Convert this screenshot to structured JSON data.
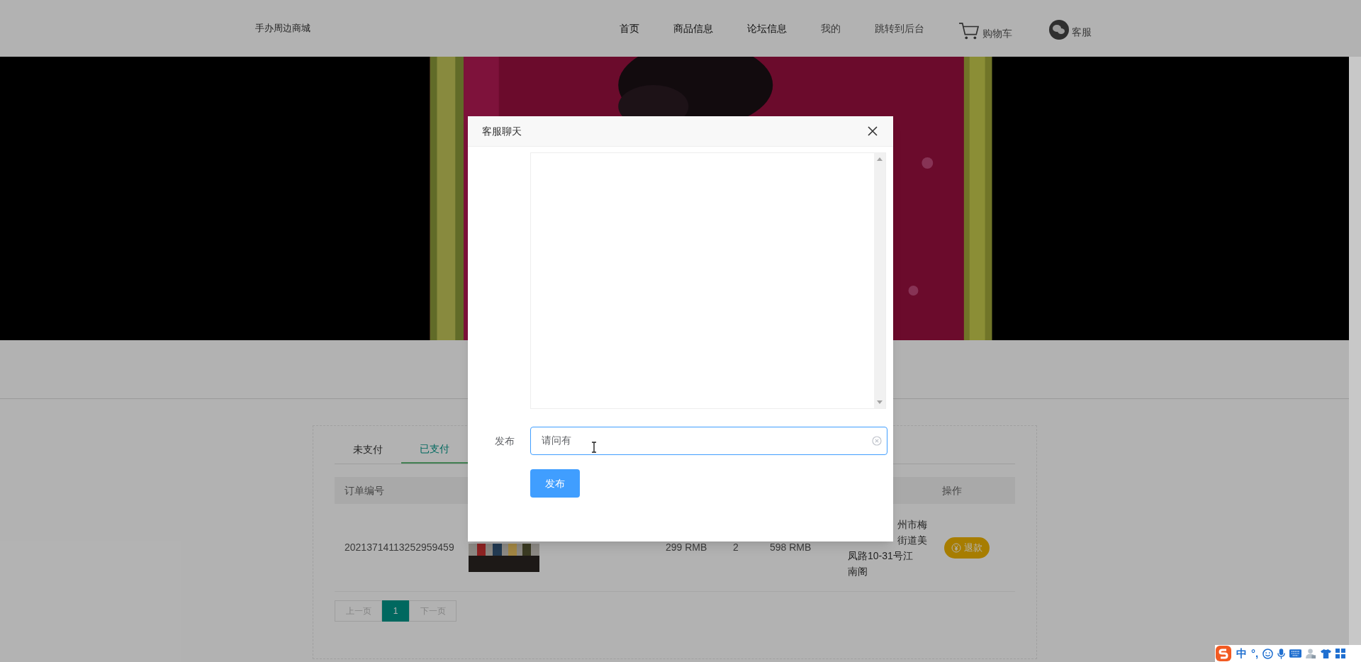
{
  "header": {
    "brand": "手办周边商城",
    "nav": [
      {
        "label": "首页",
        "kind": "link",
        "dim": false
      },
      {
        "label": "商品信息",
        "kind": "link",
        "dim": false
      },
      {
        "label": "论坛信息",
        "kind": "link",
        "dim": false
      },
      {
        "label": "我的",
        "kind": "link",
        "dim": true
      },
      {
        "label": "跳转到后台",
        "kind": "link",
        "dim": true
      },
      {
        "label": "购物车",
        "kind": "cart",
        "dim": true
      },
      {
        "label": "客服",
        "kind": "chat",
        "dim": true
      }
    ]
  },
  "orders": {
    "tabs": [
      {
        "label": "未支付",
        "selected": false
      },
      {
        "label": "已支付",
        "selected": true
      }
    ],
    "columns": [
      "订单编号",
      "操作"
    ],
    "rows": [
      {
        "order_no": "20213714113252959459",
        "price": "299 RMB",
        "quantity": "2",
        "total": "598 RMB",
        "address_lines": [
          "州市梅",
          "街道美",
          "凤路10-31号江",
          "南阁"
        ],
        "action": "退款"
      }
    ],
    "pagination": {
      "prev": "上一页",
      "pages": [
        {
          "label": "1",
          "selected": true
        }
      ],
      "next": "下一页"
    }
  },
  "dialog": {
    "title": "客服聊天",
    "label": "发布",
    "input_value": "请问有",
    "submit": "发布"
  },
  "ime": [
    {
      "kind": "logo"
    },
    {
      "kind": "text",
      "text": "中"
    },
    {
      "kind": "text",
      "text": "°,"
    },
    {
      "kind": "smiley"
    },
    {
      "kind": "mic"
    },
    {
      "kind": "keyboard"
    },
    {
      "kind": "user"
    },
    {
      "kind": "shirt"
    },
    {
      "kind": "grid"
    }
  ]
}
